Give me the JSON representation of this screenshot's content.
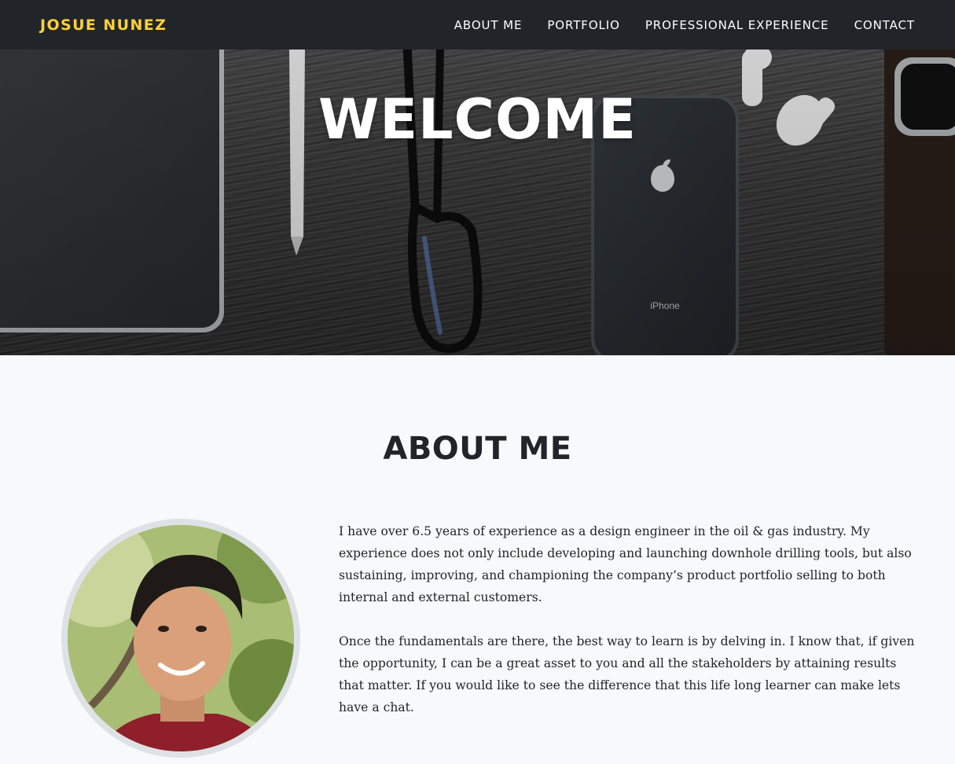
{
  "navbar": {
    "brand": "JOSUE NUNEZ",
    "links": [
      "ABOUT ME",
      "PORTFOLIO",
      "PROFESSIONAL EXPERIENCE",
      "CONTACT"
    ]
  },
  "hero": {
    "title": "WELCOME",
    "phone_label": "iPhone"
  },
  "about": {
    "title": "ABOUT ME",
    "paragraphs": [
      "I have over 6.5 years of experience as a design engineer in the oil & gas industry. My experience does not only include developing and launching downhole drilling tools, but also sustaining, improving, and championing the company’s product portfolio selling to both internal and external customers.",
      "Once the fundamentals are there, the best way to learn is by delving in. I know that, if given the opportunity, I can be a great asset to you and all the stakeholders by attaining results that matter. If you would like to see the difference that this life long learner can make lets have a chat."
    ]
  },
  "colors": {
    "navbar_bg": "#212529",
    "brand": "#fed136",
    "page_bg": "#f8f9fa",
    "avatar_border": "#dee2e6"
  }
}
